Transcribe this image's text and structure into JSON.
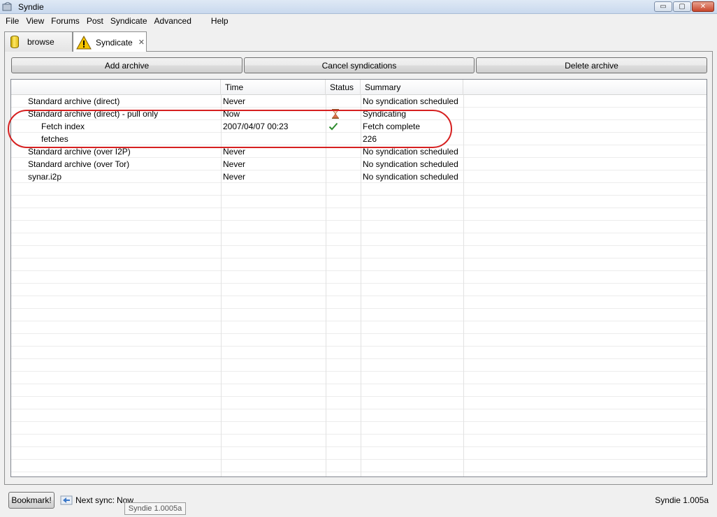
{
  "window": {
    "title": "Syndie",
    "min_glyph": "▭",
    "max_glyph": "▢",
    "close_glyph": "✕"
  },
  "menu": [
    "File",
    "View",
    "Forums",
    "Post",
    "Syndicate",
    "Advanced",
    "Help"
  ],
  "tabs": [
    {
      "label": "browse",
      "icon": "database-icon",
      "active": false
    },
    {
      "label": "Syndicate",
      "icon": "warning-icon",
      "active": true,
      "close_glyph": "✕"
    }
  ],
  "toolbar": {
    "add_archive": "Add archive",
    "cancel_syndications": "Cancel syndications",
    "delete_archive": "Delete archive"
  },
  "table": {
    "columns": [
      "",
      "Time",
      "Status",
      "Summary"
    ],
    "rows": [
      {
        "name": "Standard archive (direct)",
        "time": "Never",
        "status": "",
        "summary": "No syndication scheduled",
        "child": false
      },
      {
        "name": "Standard archive (direct) - pull only",
        "time": "Now",
        "status": "hourglass-icon",
        "summary": "Syndicating",
        "child": false
      },
      {
        "name": "Fetch index",
        "time": "2007/04/07 00:23",
        "status": "check-icon",
        "summary": "Fetch complete",
        "child": true
      },
      {
        "name": "fetches",
        "time": "",
        "status": "",
        "summary": "226",
        "child": true
      },
      {
        "name": "Standard archive (over I2P)",
        "time": "Never",
        "status": "",
        "summary": "No syndication scheduled",
        "child": false
      },
      {
        "name": "Standard archive (over Tor)",
        "time": "Never",
        "status": "",
        "summary": "No syndication scheduled",
        "child": false
      },
      {
        "name": "synar.i2p",
        "time": "Never",
        "status": "",
        "summary": "No syndication scheduled",
        "child": false
      }
    ],
    "highlight_color": "#d62020"
  },
  "statusbar": {
    "bookmark": "Bookmark!",
    "next_sync_label": "Next sync:",
    "next_sync_value": "Now",
    "tooltip": "Syndie 1.0005a",
    "version": "Syndie 1.005a"
  }
}
